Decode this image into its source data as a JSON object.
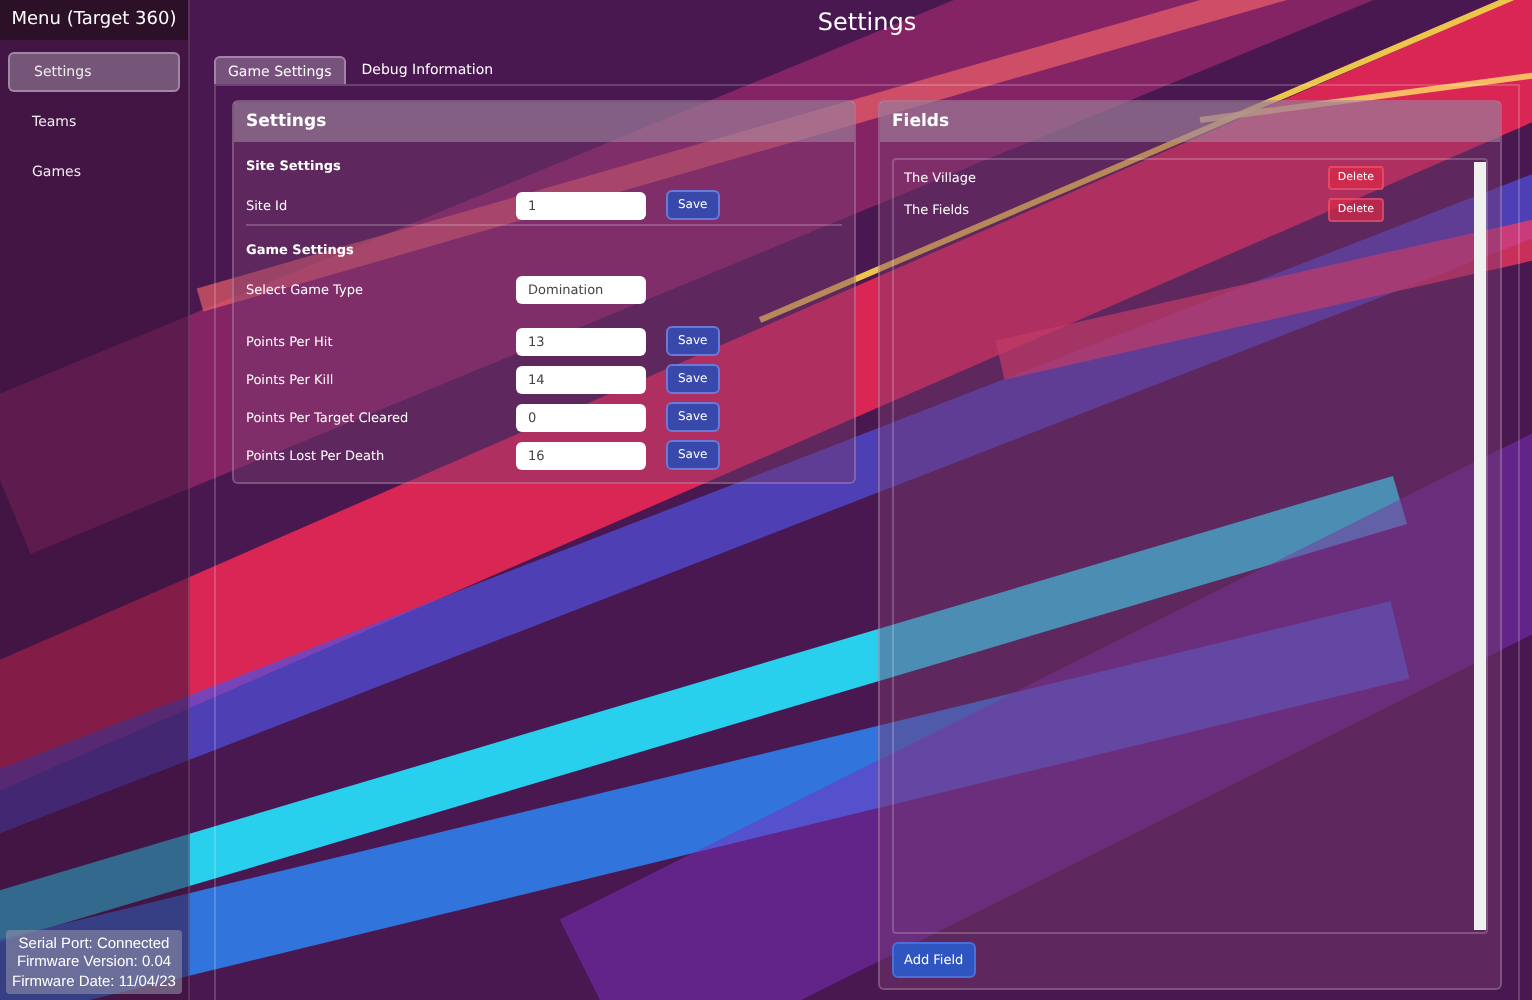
{
  "sidebar": {
    "title": "Menu (Target 360)",
    "items": [
      {
        "label": "Settings",
        "selected": true
      },
      {
        "label": "Teams",
        "selected": false
      },
      {
        "label": "Games",
        "selected": false
      }
    ],
    "status": [
      "Serial Port: Connected",
      "Firmware Version: 0.04",
      "Firmware Date: 11/04/23"
    ]
  },
  "page_title": "Settings",
  "tabs": [
    {
      "label": "Game Settings",
      "selected": true
    },
    {
      "label": "Debug Information",
      "selected": false
    }
  ],
  "settings_card": {
    "title": "Settings",
    "sections": [
      {
        "heading": "Site Settings",
        "rows": [
          {
            "kind": "input",
            "label": "Site Id",
            "value": "1",
            "button": "Save"
          }
        ]
      },
      {
        "heading": "Game Settings",
        "rows": [
          {
            "kind": "select",
            "label": "Select Game Type",
            "value": "Domination"
          },
          {
            "kind": "input",
            "label": "Points Per Hit",
            "value": "13",
            "button": "Save"
          },
          {
            "kind": "input",
            "label": "Points Per Kill",
            "value": "14",
            "button": "Save"
          },
          {
            "kind": "input",
            "label": "Points Per Target Cleared",
            "value": "0",
            "button": "Save"
          },
          {
            "kind": "input",
            "label": "Points Lost Per Death",
            "value": "16",
            "button": "Save"
          }
        ]
      }
    ]
  },
  "fields_card": {
    "title": "Fields",
    "items": [
      {
        "name": "The Village",
        "button": "Delete"
      },
      {
        "name": "The Fields",
        "button": "Delete"
      }
    ],
    "add_button": "Add Field"
  }
}
